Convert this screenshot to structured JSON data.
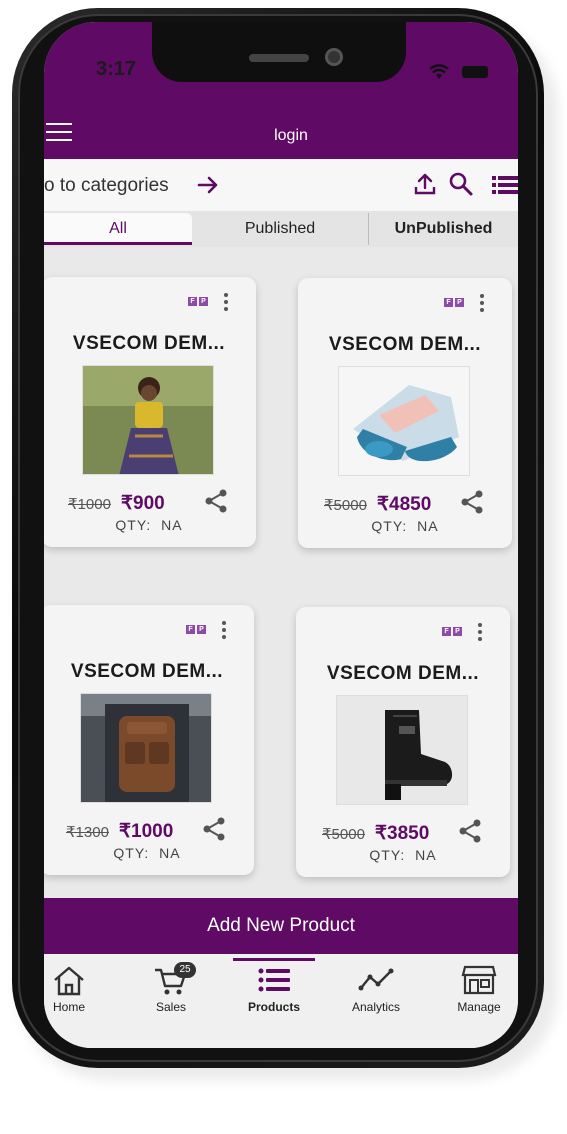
{
  "status_bar": {
    "time": "3:17"
  },
  "header": {
    "title": "login"
  },
  "category_bar": {
    "link_text": "o to categories"
  },
  "tabs": [
    {
      "label": "All"
    },
    {
      "label": "Published"
    },
    {
      "label": "UnPublished"
    }
  ],
  "products": [
    {
      "title": "VSECOM DEM...",
      "mrp": "₹1000",
      "price": "₹900",
      "qty_label": "QTY:",
      "qty_value": "NA",
      "badge": [
        "F",
        "P"
      ]
    },
    {
      "title": "VSECOM DEM...",
      "mrp": "₹5000",
      "price": "₹4850",
      "qty_label": "QTY:",
      "qty_value": "NA",
      "badge": [
        "F",
        "P"
      ]
    },
    {
      "title": "VSECOM DEM...",
      "mrp": "₹1300",
      "price": "₹1000",
      "qty_label": "QTY:",
      "qty_value": "NA",
      "badge": [
        "F",
        "P"
      ]
    },
    {
      "title": "VSECOM DEM...",
      "mrp": "₹5000",
      "price": "₹3850",
      "qty_label": "QTY:",
      "qty_value": "NA",
      "badge": [
        "F",
        "P"
      ]
    }
  ],
  "add_button": {
    "label": "Add New Product"
  },
  "bottom_nav": [
    {
      "label": "Home",
      "icon": "home-icon"
    },
    {
      "label": "Sales",
      "icon": "cart-icon",
      "badge": "25"
    },
    {
      "label": "Products",
      "icon": "list-icon",
      "active": true
    },
    {
      "label": "Analytics",
      "icon": "analytics-icon"
    },
    {
      "label": "Manage",
      "icon": "store-icon"
    }
  ],
  "colors": {
    "brand": "#5f0a64",
    "background": "#e9e9e9"
  }
}
